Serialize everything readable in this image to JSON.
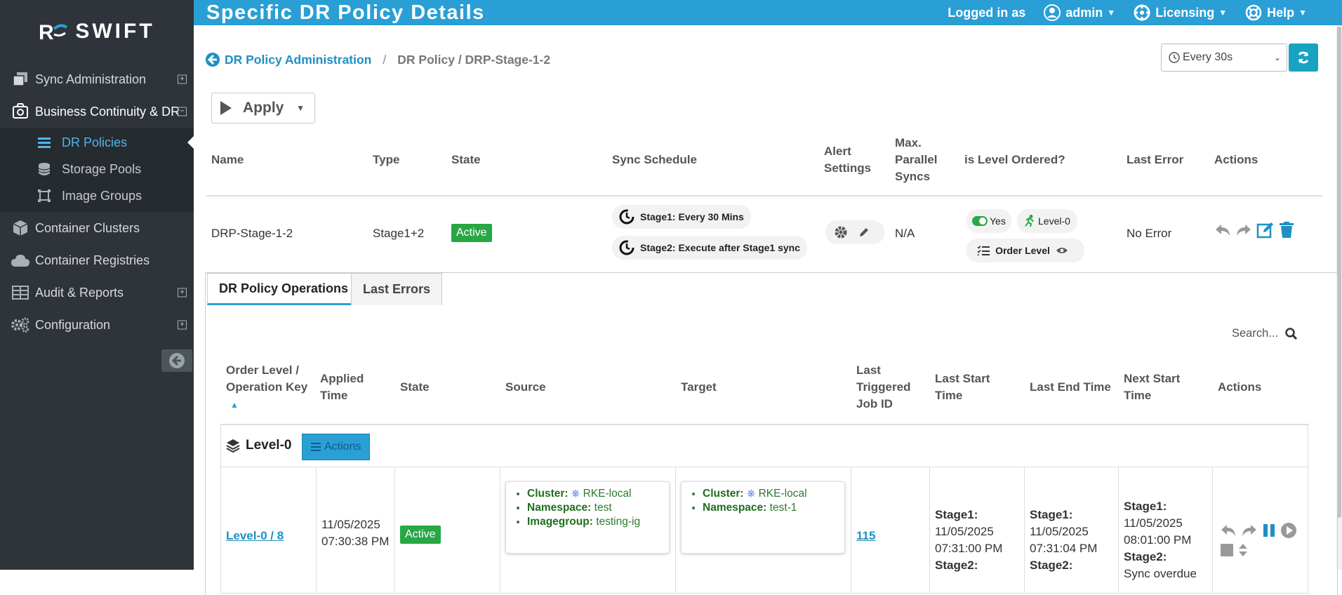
{
  "sidebar": {
    "logo": "SWIFT",
    "logo_mark": "R",
    "items": [
      {
        "label": "Sync Administration",
        "expander": "+"
      },
      {
        "label": "Business Continuity & DR",
        "expander": "−"
      },
      {
        "label": "Container Clusters"
      },
      {
        "label": "Container Registries"
      },
      {
        "label": "Audit & Reports",
        "expander": "+"
      },
      {
        "label": "Configuration",
        "expander": "+"
      }
    ],
    "subitems": [
      {
        "label": "DR Policies"
      },
      {
        "label": "Storage Pools"
      },
      {
        "label": "Image Groups"
      }
    ]
  },
  "topbar": {
    "title": "Specific DR Policy Details",
    "logged_in_label": "Logged in as",
    "user": "admin",
    "licensing": "Licensing",
    "help": "Help"
  },
  "breadcrumb": {
    "parent": "DR Policy Administration",
    "separator": "/",
    "current": "DR Policy / DRP-Stage-1-2"
  },
  "refresh": {
    "interval": "Every 30s"
  },
  "apply_button": {
    "label": "Apply"
  },
  "policy_table": {
    "headers": {
      "name": "Name",
      "type": "Type",
      "state": "State",
      "sync_schedule": "Sync Schedule",
      "alert_settings_1": "Alert",
      "alert_settings_2": "Settings",
      "max_1": "Max.",
      "max_2": "Parallel",
      "max_3": "Syncs",
      "level_ordered": "is Level Ordered?",
      "last_error": "Last Error",
      "actions": "Actions"
    },
    "row": {
      "name": "DRP-Stage-1-2",
      "type": "Stage1+2",
      "state": "Active",
      "schedule_1": "Stage1: Every 30 Mins",
      "schedule_2": "Stage2: Execute after Stage1 sync",
      "max_parallel": "N/A",
      "level_ordered_yes": "Yes",
      "level_ordered_level": "Level-0",
      "order_level": "Order Level",
      "last_error": "No Error"
    }
  },
  "tabs": [
    {
      "label": "DR Policy Operations"
    },
    {
      "label": "Last Errors"
    }
  ],
  "search": {
    "label": "Search..."
  },
  "ops_table": {
    "headers": {
      "order_1": "Order Level /",
      "order_2": "Operation Key",
      "applied_1": "Applied",
      "applied_2": "Time",
      "state": "State",
      "source": "Source",
      "target": "Target",
      "job_1": "Last",
      "job_2": "Triggered",
      "job_3": "Job ID",
      "start_1": "Last Start",
      "start_2": "Time",
      "end": "Last End Time",
      "next_1": "Next Start",
      "next_2": "Time",
      "actions": "Actions"
    },
    "group": {
      "label": "Level-0",
      "actions_label": "Actions"
    },
    "row": {
      "key": "Level-0 / 8",
      "applied_date": "11/05/2025",
      "applied_time": "07:30:38 PM",
      "state": "Active",
      "source_cluster_label": "Cluster:",
      "source_cluster": "RKE-local",
      "source_ns_label": "Namespace:",
      "source_ns": "test",
      "source_ig_label": "Imagegroup:",
      "source_ig": "testing-ig",
      "target_cluster_label": "Cluster:",
      "target_cluster": "RKE-local",
      "target_ns_label": "Namespace:",
      "target_ns": "test-1",
      "job_id": "115",
      "start_stage1": "Stage1:",
      "start_date": "11/05/2025",
      "start_time": "07:31:00 PM",
      "start_stage2": "Stage2:",
      "end_stage1": "Stage1:",
      "end_date": "11/05/2025",
      "end_time": "07:31:04 PM",
      "end_stage2": "Stage2:",
      "next_stage1": "Stage1:",
      "next_date": "11/05/2025",
      "next_time": "08:01:00 PM",
      "next_stage2": "Stage2:",
      "next_stage2_value": "Sync overdue"
    }
  },
  "colors": {
    "sidebar_bg": "#2e3439",
    "topbar_bg": "#2a9fd6",
    "active_green": "#28a745",
    "link_blue": "#1f8fc4"
  }
}
